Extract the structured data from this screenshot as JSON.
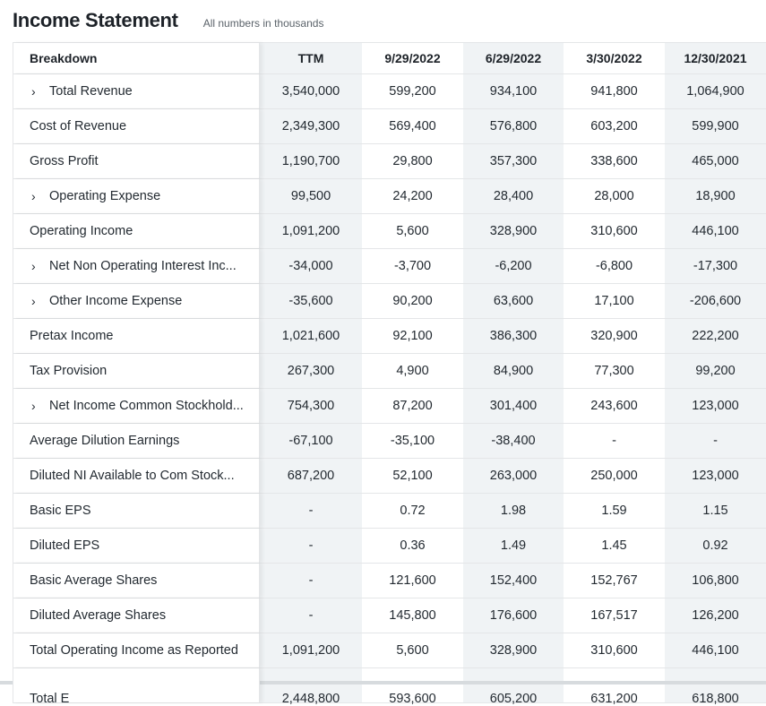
{
  "page": {
    "title": "Income Statement",
    "subtitle": "All numbers in thousands"
  },
  "colors": {
    "shaded_column": "#f0f3f5",
    "border": "#e4e6e8",
    "text": "#232a31"
  },
  "table": {
    "columns": [
      "Breakdown",
      "TTM",
      "9/29/2022",
      "6/29/2022",
      "3/30/2022",
      "12/30/2021"
    ],
    "rows": [
      {
        "label": "Total Revenue",
        "expandable": true,
        "values": [
          "3,540,000",
          "599,200",
          "934,100",
          "941,800",
          "1,064,900"
        ]
      },
      {
        "label": "Cost of Revenue",
        "expandable": false,
        "values": [
          "2,349,300",
          "569,400",
          "576,800",
          "603,200",
          "599,900"
        ]
      },
      {
        "label": "Gross Profit",
        "expandable": false,
        "values": [
          "1,190,700",
          "29,800",
          "357,300",
          "338,600",
          "465,000"
        ]
      },
      {
        "label": "Operating Expense",
        "expandable": true,
        "values": [
          "99,500",
          "24,200",
          "28,400",
          "28,000",
          "18,900"
        ]
      },
      {
        "label": "Operating Income",
        "expandable": false,
        "values": [
          "1,091,200",
          "5,600",
          "328,900",
          "310,600",
          "446,100"
        ]
      },
      {
        "label": "Net Non Operating Interest Inc...",
        "expandable": true,
        "values": [
          "-34,000",
          "-3,700",
          "-6,200",
          "-6,800",
          "-17,300"
        ]
      },
      {
        "label": "Other Income Expense",
        "expandable": true,
        "values": [
          "-35,600",
          "90,200",
          "63,600",
          "17,100",
          "-206,600"
        ]
      },
      {
        "label": "Pretax Income",
        "expandable": false,
        "values": [
          "1,021,600",
          "92,100",
          "386,300",
          "320,900",
          "222,200"
        ]
      },
      {
        "label": "Tax Provision",
        "expandable": false,
        "values": [
          "267,300",
          "4,900",
          "84,900",
          "77,300",
          "99,200"
        ]
      },
      {
        "label": "Net Income Common Stockhold...",
        "expandable": true,
        "values": [
          "754,300",
          "87,200",
          "301,400",
          "243,600",
          "123,000"
        ]
      },
      {
        "label": "Average Dilution Earnings",
        "expandable": false,
        "values": [
          "-67,100",
          "-35,100",
          "-38,400",
          "-",
          "-"
        ]
      },
      {
        "label": "Diluted NI Available to Com Stock...",
        "expandable": false,
        "values": [
          "687,200",
          "52,100",
          "263,000",
          "250,000",
          "123,000"
        ]
      },
      {
        "label": "Basic EPS",
        "expandable": false,
        "values": [
          "-",
          "0.72",
          "1.98",
          "1.59",
          "1.15"
        ]
      },
      {
        "label": "Diluted EPS",
        "expandable": false,
        "values": [
          "-",
          "0.36",
          "1.49",
          "1.45",
          "0.92"
        ]
      },
      {
        "label": "Basic Average Shares",
        "expandable": false,
        "values": [
          "-",
          "121,600",
          "152,400",
          "152,767",
          "106,800"
        ]
      },
      {
        "label": "Diluted Average Shares",
        "expandable": false,
        "values": [
          "-",
          "145,800",
          "176,600",
          "167,517",
          "126,200"
        ]
      },
      {
        "label": "Total Operating Income as Reported",
        "expandable": false,
        "values": [
          "1,091,200",
          "5,600",
          "328,900",
          "310,600",
          "446,100"
        ]
      },
      {
        "label": "Total E",
        "expandable": false,
        "values": [
          "2,448,800",
          "593,600",
          "605,200",
          "631,200",
          "618,800"
        ]
      }
    ]
  }
}
